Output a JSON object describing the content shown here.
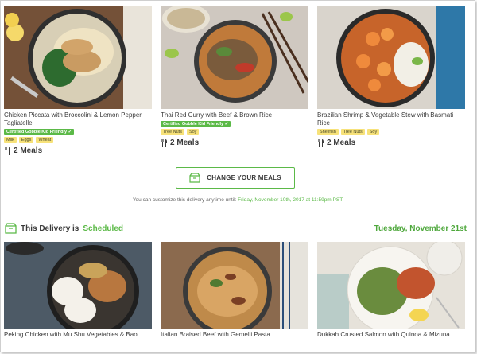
{
  "top_meals": [
    {
      "title": "Chicken Piccata with Broccolini & Lemon Pepper Tagliatelle",
      "badges": [
        {
          "label": "Certified Gobble Kid Friendly ✓",
          "kind": "green"
        },
        {
          "label": "Milk",
          "kind": "yellow"
        },
        {
          "label": "Eggs",
          "kind": "yellow"
        },
        {
          "label": "Wheat",
          "kind": "yellow"
        }
      ],
      "meals": "2 Meals"
    },
    {
      "title": "Thai Red Curry with Beef & Brown Rice",
      "badges": [
        {
          "label": "Certified Gobble Kid Friendly ✓",
          "kind": "green"
        },
        {
          "label": "Tree Nuts",
          "kind": "yellow"
        },
        {
          "label": "Soy",
          "kind": "yellow"
        }
      ],
      "meals": "2 Meals"
    },
    {
      "title": "Brazilian Shrimp & Vegetable Stew with Basmati Rice",
      "badges": [
        {
          "label": "Shellfish",
          "kind": "yellow"
        },
        {
          "label": "Tree Nuts",
          "kind": "yellow"
        },
        {
          "label": "Soy",
          "kind": "yellow"
        }
      ],
      "meals": "2 Meals"
    }
  ],
  "change_button": {
    "label": "CHANGE YOUR MEALS",
    "icon": "box-icon"
  },
  "customize": {
    "text": "You can customize this delivery anytime until:",
    "deadline": "Friday, November 10th, 2017 at 11:59pm PST"
  },
  "delivery": {
    "prefix": "This Delivery is",
    "status": "Scheduled",
    "date": "Tuesday, November 21st"
  },
  "bottom_meals": [
    {
      "title": "Peking Chicken with Mu Shu Vegetables & Bao"
    },
    {
      "title": "Italian Braised Beef with Gemelli Pasta"
    },
    {
      "title": "Dukkah Crusted Salmon with Quinoa & Mizuna"
    }
  ],
  "colors": {
    "accent_green": "#5bb947",
    "allergen_yellow": "#f7e27a"
  }
}
